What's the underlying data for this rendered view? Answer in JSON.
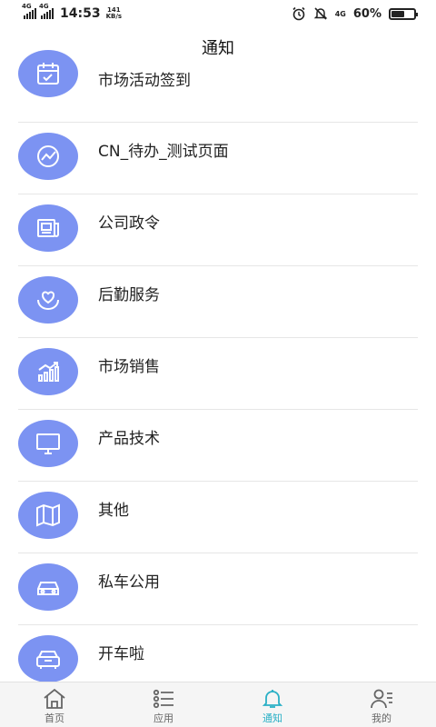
{
  "status_bar": {
    "net1": "4G",
    "net2": "4G",
    "time": "14:53",
    "speed_value": "141",
    "speed_unit": "KB/s",
    "net3": "4G",
    "battery": "60%",
    "battery_level": 0.6
  },
  "header": {
    "title": "通知"
  },
  "list": [
    {
      "label": "市场活动签到",
      "icon": "calendar-check-icon"
    },
    {
      "label": "CN_待办_测试页面",
      "icon": "chart-line-icon"
    },
    {
      "label": "公司政令",
      "icon": "newspaper-icon"
    },
    {
      "label": "后勤服务",
      "icon": "heart-hands-icon"
    },
    {
      "label": "市场销售",
      "icon": "bar-chart-trend-icon"
    },
    {
      "label": "产品技术",
      "icon": "monitor-icon"
    },
    {
      "label": "其他",
      "icon": "map-icon"
    },
    {
      "label": "私车公用",
      "icon": "car-icon"
    },
    {
      "label": "开车啦",
      "icon": "car-front-icon"
    }
  ],
  "tabbar": {
    "tabs": [
      {
        "label": "首页",
        "icon": "home-icon",
        "active": false
      },
      {
        "label": "应用",
        "icon": "list-icon",
        "active": false
      },
      {
        "label": "通知",
        "icon": "bell-icon",
        "active": true
      },
      {
        "label": "我的",
        "icon": "user-icon",
        "active": false
      }
    ]
  },
  "colors": {
    "icon_bg": "#7c93f2",
    "active_tab": "#2ab0c6"
  }
}
